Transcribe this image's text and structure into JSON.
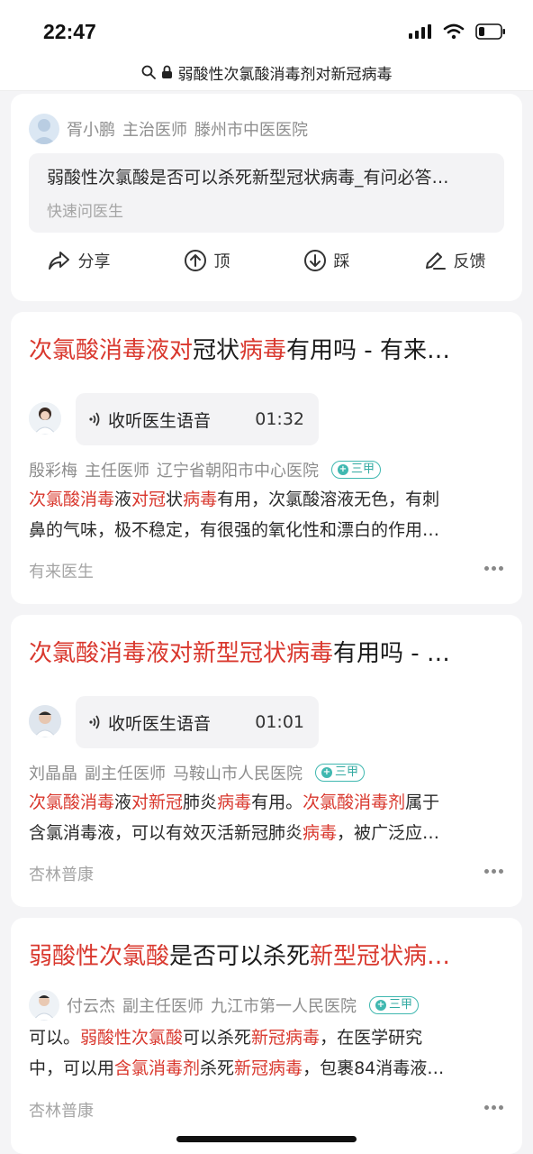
{
  "status": {
    "time": "22:47"
  },
  "url": {
    "title": "弱酸性次氯酸消毒剂对新冠病毒"
  },
  "top_card": {
    "author": "胥小鹏",
    "role": "主治医师",
    "hospital": "滕州市中医医院",
    "quote_text": "弱酸性次氯酸是否可以杀死新型冠状病毒_有问必答…",
    "quote_source": "快速问医生",
    "actions": [
      {
        "label": "分享",
        "icon": "share-icon"
      },
      {
        "label": "顶",
        "icon": "upvote-icon"
      },
      {
        "label": "踩",
        "icon": "downvote-icon"
      },
      {
        "label": "反馈",
        "icon": "feedback-icon"
      }
    ]
  },
  "results": [
    {
      "title_parts": [
        {
          "text": "次氯酸消毒液对",
          "hl": true
        },
        {
          "text": "冠状",
          "hl": false
        },
        {
          "text": "病毒",
          "hl": true
        },
        {
          "text": "有用吗 - 有来…",
          "hl": false
        }
      ],
      "voice": {
        "label": "收听医生语音",
        "duration": "01:32"
      },
      "author": "殷彩梅",
      "role": "主任医师",
      "hospital": "辽宁省朝阳市中心医院",
      "badge": "三甲",
      "snippet_lines": [
        [
          {
            "text": "次氯酸消毒",
            "hl": true
          },
          {
            "text": "液",
            "hl": false
          },
          {
            "text": "对冠",
            "hl": true
          },
          {
            "text": "状",
            "hl": false
          },
          {
            "text": "病毒",
            "hl": true
          },
          {
            "text": "有用，次氯酸溶液无色，有刺",
            "hl": false
          }
        ],
        [
          {
            "text": "鼻的气味，极不稳定，有很强的氧化性和漂白的作用…",
            "hl": false
          }
        ]
      ],
      "source": "有来医生"
    },
    {
      "title_parts": [
        {
          "text": "次氯酸消毒液对新型冠状病毒",
          "hl": true
        },
        {
          "text": "有用吗 - …",
          "hl": false
        }
      ],
      "voice": {
        "label": "收听医生语音",
        "duration": "01:01"
      },
      "author": "刘晶晶",
      "role": "副主任医师",
      "hospital": "马鞍山市人民医院",
      "badge": "三甲",
      "snippet_lines": [
        [
          {
            "text": "次氯酸消毒",
            "hl": true
          },
          {
            "text": "液",
            "hl": false
          },
          {
            "text": "对新冠",
            "hl": true
          },
          {
            "text": "肺炎",
            "hl": false
          },
          {
            "text": "病毒",
            "hl": true
          },
          {
            "text": "有用。",
            "hl": false
          },
          {
            "text": "次氯酸消毒剂",
            "hl": true
          },
          {
            "text": "属于",
            "hl": false
          }
        ],
        [
          {
            "text": "含氯消毒液，可以有效灭活新冠肺炎",
            "hl": false
          },
          {
            "text": "病毒",
            "hl": true
          },
          {
            "text": "，被广泛应…",
            "hl": false
          }
        ]
      ],
      "source": "杏林普康"
    },
    {
      "title_parts": [
        {
          "text": "弱酸性次氯酸",
          "hl": true
        },
        {
          "text": "是否可以杀死",
          "hl": false
        },
        {
          "text": "新型冠状病…",
          "hl": true
        }
      ],
      "author": "付云杰",
      "role": "副主任医师",
      "hospital": "九江市第一人民医院",
      "badge": "三甲",
      "snippet_lines": [
        [
          {
            "text": "可以。",
            "hl": false
          },
          {
            "text": "弱酸性次氯酸",
            "hl": true
          },
          {
            "text": "可以杀死",
            "hl": false
          },
          {
            "text": "新冠病毒",
            "hl": true
          },
          {
            "text": "，在医学研究",
            "hl": false
          }
        ],
        [
          {
            "text": "中，可以用",
            "hl": false
          },
          {
            "text": "含氯消毒剂",
            "hl": true
          },
          {
            "text": "杀死",
            "hl": false
          },
          {
            "text": "新冠病毒",
            "hl": true
          },
          {
            "text": "，包裹84消毒液…",
            "hl": false
          }
        ]
      ],
      "source": "杏林普康"
    }
  ]
}
